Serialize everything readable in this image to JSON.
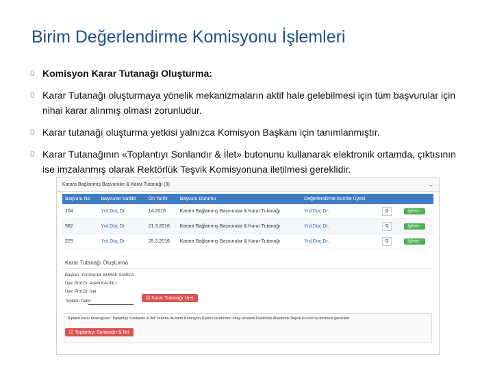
{
  "slide": {
    "title": "Birim Değerlendirme Komisyonu İşlemleri",
    "bullet_mark": "0",
    "bullets": [
      "Komisyon Karar Tutanağı Oluşturma:",
      "Karar Tutanağı oluşturmaya yönelik mekanizmaların aktif hale gelebilmesi için tüm başvurular için nihai karar alınmış olması zorunludur.",
      "Karar tutanağı oluşturma yetkisi yalnızca Komisyon Başkanı için tanımlanmıştır.",
      "Karar Tutanağının «Toplantıyı Sonlandır & İlet» butonunu kullanarak elektronik ortamda, çıktısının ise imzalanmış olarak Rektörlük Teşvik Komisyonuna iletilmesi gereklidir."
    ]
  },
  "screenshot": {
    "header": "Karara Bağlanmış Başvurular & Karar Tutanağı (3)",
    "chevron": "⌄",
    "columns": [
      "Başvuru No",
      "Başvuran Sahibi",
      "Ön Tarihi",
      "Başvuru Durumu",
      "Değerlendirme Komite Üyesi",
      "",
      ""
    ],
    "rows": [
      {
        "no": "104",
        "owner": "Yrd.Doç.Dr.",
        "date": "14.2016",
        "status": "Karara Bağlanmış Başvurular & Karar Tutanağı",
        "member": "Yrd.Doç.Dr.",
        "action": "İşlem -"
      },
      {
        "no": "582",
        "owner": "Yrd.Doç.Dr.",
        "date": "21.3.2016",
        "status": "Karara Bağlanmış Başvurular & Karar Tutanağı",
        "member": "Yrd.Doç.Dr.",
        "action": "İşlem -"
      },
      {
        "no": "225",
        "owner": "Yrd.Doç.Dr.",
        "date": "25.3.2016",
        "status": "Karara Bağlanmış Başvurular & Karar Tutanağı",
        "member": "Yrd.Doç.Dr.",
        "action": "İşlem -"
      }
    ],
    "form_title": "Karar Tutanağı Oluşturma",
    "baskan": "Başkan: Yrd.Doç.Dr. BURAK SARICA",
    "uye1": "Üye: Prof.Dr. Adem KALINLI",
    "uye2": "Üye: Prof.Dr. İzet",
    "tarih_label": "Toplantı Tarihi:",
    "create_button": "☑ Karar Tutanağı Üret",
    "notice_text": "Toplantı karar tutanağının \"Toplantıyı Sonlandır & İlet\" butonu ile birim Komisyon Üyeleri tarafından onay alınarak Rektörlük Akademik Teşvik Kurulu'na iletilmesi gereklidir.",
    "finish_button": "☑ Toplantıyı Sonlandır & İlet"
  },
  "colors": {
    "title": "#1f4e8c",
    "table_header": "#3e7cc4",
    "green": "#4caf50",
    "red": "#d9534f"
  }
}
